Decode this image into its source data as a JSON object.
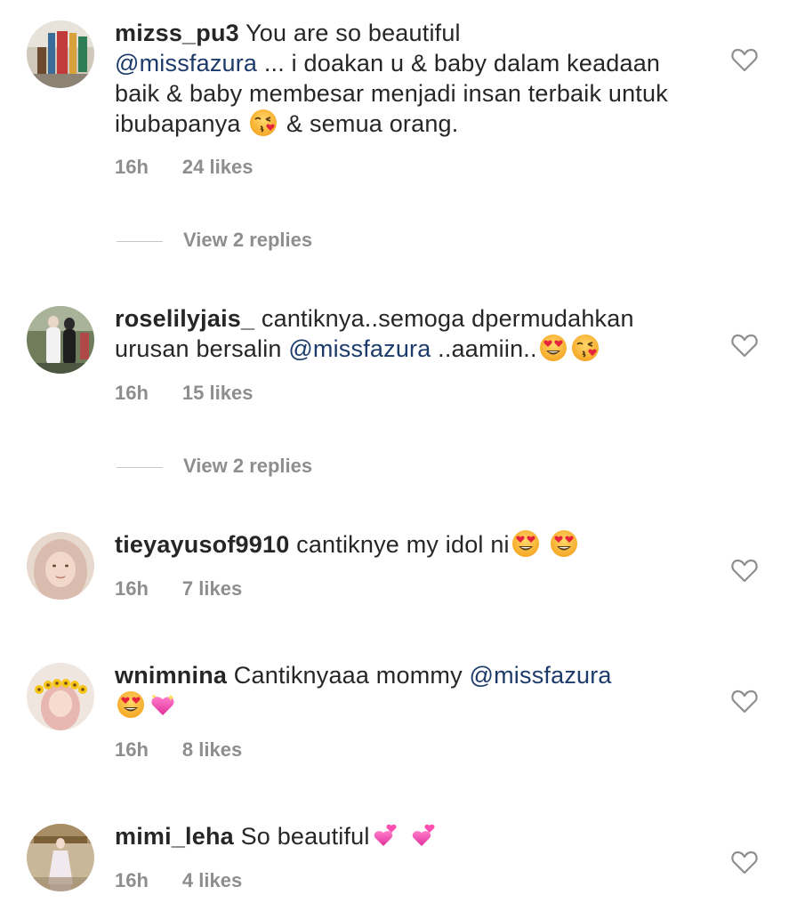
{
  "comments": [
    {
      "username": "mizss_pu3",
      "text_1": " You are so beautiful ",
      "mention": "@missfazura",
      "text_2": " ... i doakan u & baby dalam keadaan baik & baby membesar menjadi insan terbaik untuk ibubapanya ",
      "text_3": " & semua orang.",
      "time": "16h",
      "likes": "24 likes",
      "replies": "View 2 replies"
    },
    {
      "username": "roselilyjais_",
      "text_1": " cantiknya..semoga dpermudahkan urusan bersalin ",
      "mention": "@missfazura",
      "text_2": " ..aamiin..",
      "time": "16h",
      "likes": "15 likes",
      "replies": "View 2 replies"
    },
    {
      "username": "tieyayusof9910",
      "text_1": " cantiknye my idol ni",
      "time": "16h",
      "likes": "7 likes"
    },
    {
      "username": "wnimnina",
      "text_1": " Cantiknyaaa mommy ",
      "mention": "@missfazura",
      "time": "16h",
      "likes": "8 likes"
    },
    {
      "username": "mimi_leha",
      "text_1": " So beautiful",
      "time": "16h",
      "likes": "4 likes"
    }
  ],
  "icons": {
    "like": "heart-outline-icon",
    "emoji_kiss": "face-blowing-kiss-emoji",
    "emoji_heart_eyes": "smiling-face-heart-eyes-emoji",
    "emoji_sparkling_heart": "sparkling-heart-emoji",
    "emoji_two_hearts": "revolving-hearts-emoji"
  },
  "colors": {
    "text": "#262626",
    "meta": "#8e8e8e",
    "mention": "#1c3b6b"
  }
}
